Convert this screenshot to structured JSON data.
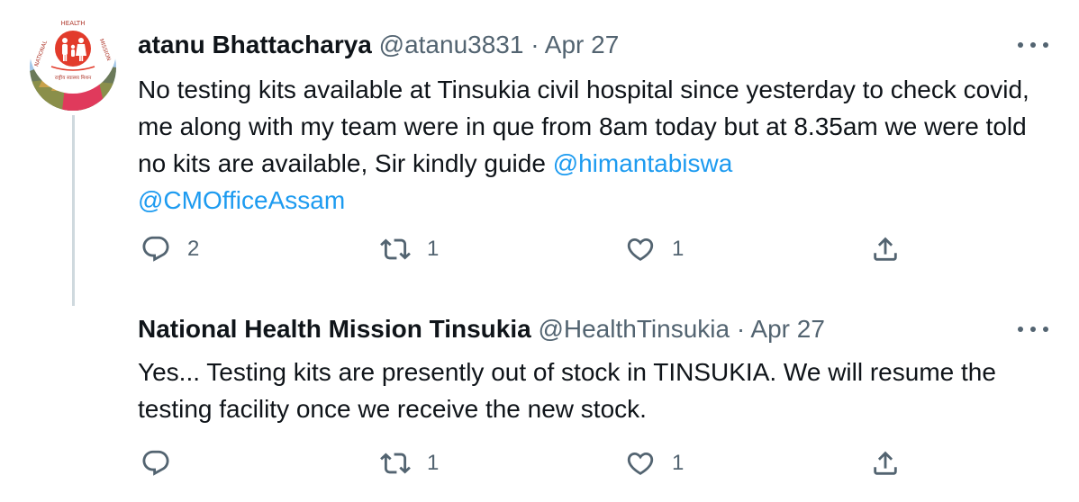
{
  "tweets": [
    {
      "display_name": "atanu Bhattacharya",
      "handle": "@atanu3831",
      "separator": "·",
      "date": "Apr 27",
      "text_plain": "No testing kits available at Tinsukia civil hospital since yesterday to check covid, me along with my team were in que from 8am today but at 8.35am we were told no kits are available, Sir kindly guide ",
      "mention_1": "@himantabiswa",
      "mention_2": "@CMOfficeAssam",
      "reply_count": "2",
      "retweet_count": "1",
      "like_count": "1"
    },
    {
      "display_name": "National Health Mission Tinsukia",
      "handle": "@HealthTinsukia",
      "separator": "·",
      "date": "Apr 27",
      "text_plain": "Yes... Testing kits are presently out of stock in TINSUKIA. We will resume the testing facility once we receive the new stock.",
      "reply_count": "",
      "retweet_count": "1",
      "like_count": "1"
    }
  ],
  "logo_text": {
    "top": "HEALTH",
    "left": "NATIONAL",
    "right": "MISSION",
    "bottom": "राष्ट्रीय स्वास्थ्य मिशन"
  },
  "icons": {
    "reply": "reply-icon",
    "retweet": "retweet-icon",
    "like": "heart-icon",
    "share": "share-icon",
    "more": "more-icon"
  },
  "colors": {
    "link": "#1d9bf0",
    "secondary_text": "#536471",
    "thread_line": "#cfd9de",
    "logo_red": "#e23b2b"
  }
}
